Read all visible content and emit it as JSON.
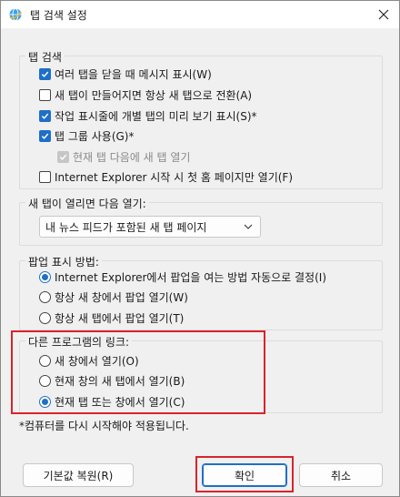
{
  "window": {
    "title": "탭 검색 설정",
    "close_symbol": "✕"
  },
  "tabbed_browsing": {
    "title": "탭 검색",
    "options": [
      {
        "label": "여러 탭을 닫을 때 메시지 표시(W)",
        "checked": true,
        "disabled": false
      },
      {
        "label": "새 탭이 만들어지면 항상 새 탭으로 전환(A)",
        "checked": false,
        "disabled": false
      },
      {
        "label": "작업 표시줄에 개별 탭의 미리 보기 표시(S)*",
        "checked": true,
        "disabled": false
      },
      {
        "label": "탭 그룹 사용(G)*",
        "checked": true,
        "disabled": false
      },
      {
        "label": "현재 탭 다음에 새 탭 열기",
        "checked": true,
        "disabled": true
      },
      {
        "label": "Internet Explorer 시작 시 첫 홈 페이지만 열기(F)",
        "checked": false,
        "disabled": false
      }
    ]
  },
  "new_tab": {
    "title": "새 탭이 열리면 다음 열기:",
    "selected": "내 뉴스 피드가 포함된 새 탭 페이지"
  },
  "popups": {
    "title": "팝업 표시 방법:",
    "options": [
      {
        "label": "Internet Explorer에서 팝업을 여는 방법 자동으로 결정(I)",
        "checked": true
      },
      {
        "label": "항상 새 창에서 팝업 열기(W)",
        "checked": false
      },
      {
        "label": "항상 새 탭에서 팝업 열기(T)",
        "checked": false
      }
    ]
  },
  "other_programs": {
    "title": "다른 프로그램의 링크:",
    "options": [
      {
        "label": "새 창에서 열기(O)",
        "checked": false
      },
      {
        "label": "현재 창의 새 탭에서 열기(B)",
        "checked": false
      },
      {
        "label": "현재 탭 또는 창에서 열기(C)",
        "checked": true
      }
    ]
  },
  "footer": {
    "note": "*컴퓨터를 다시 시작해야 적용됩니다.",
    "restore_label": "기본값 복원(R)",
    "ok_label": "확인",
    "cancel_label": "취소"
  },
  "colors": {
    "accent": "#1e6fc7",
    "highlight": "#d9232c"
  },
  "icons": {
    "app": "ie-globe-icon",
    "close": "close-icon",
    "dropdown": "chevron-down-icon",
    "check": "check-icon"
  }
}
